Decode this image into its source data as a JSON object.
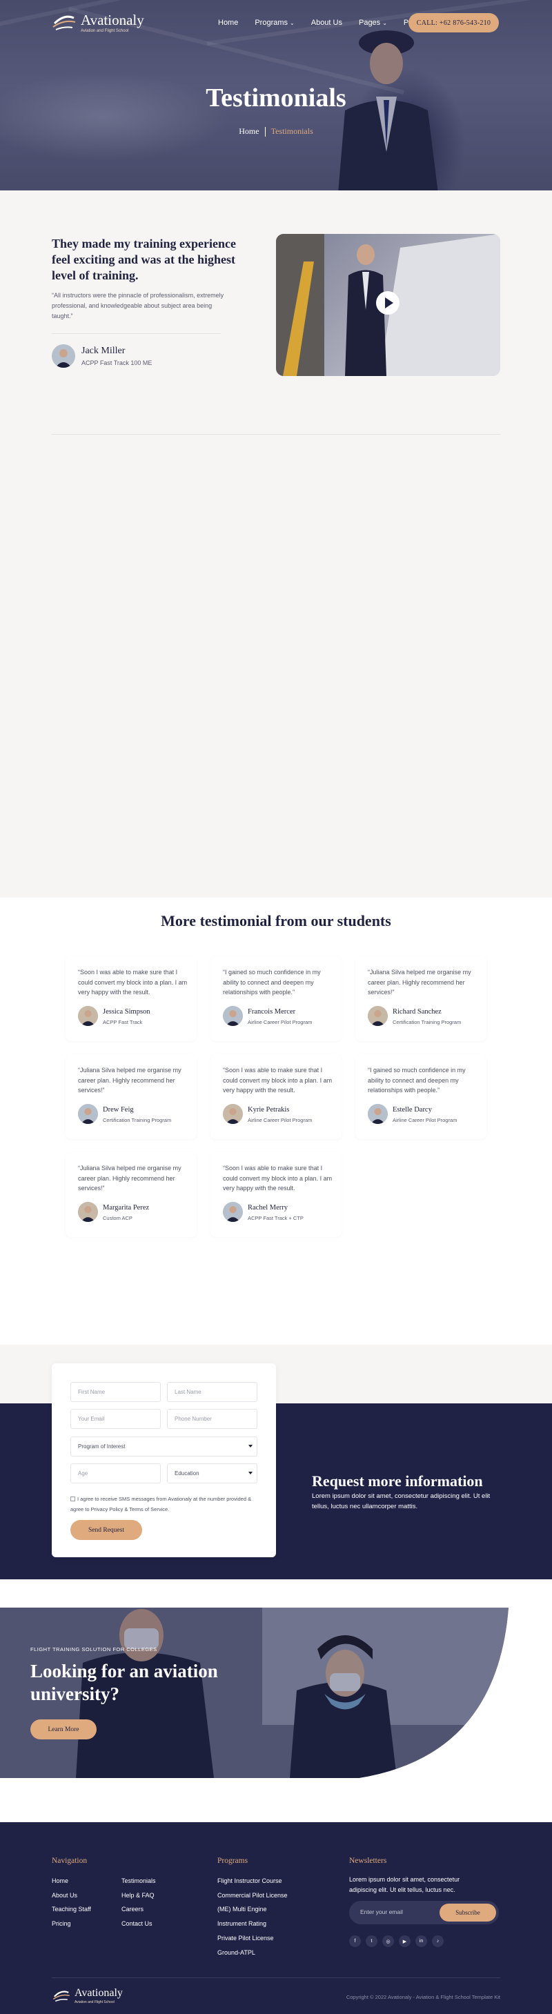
{
  "brand": {
    "name": "Avationaly",
    "tagline": "Aviation and Flight School"
  },
  "nav": {
    "items": [
      {
        "label": "Home"
      },
      {
        "label": "Programs",
        "dropdown": true
      },
      {
        "label": "About Us"
      },
      {
        "label": "Pages",
        "dropdown": true
      },
      {
        "label": "Pricing"
      }
    ],
    "call_label": "CALL: +62 876-543-210"
  },
  "hero": {
    "title": "Testimonials",
    "breadcrumb_home": "Home",
    "breadcrumb_current": "Testimonials"
  },
  "featured": {
    "heading": "They made my training experience feel exciting and was at the highest level of training.",
    "quote": "“All instructors were the pinnacle of professionalism, extremely professional, and knowledgeable about subject area being taught.”",
    "author_name": "Jack Miller",
    "author_role": "ACPP Fast Track 100 ME",
    "play_icon": "play-icon"
  },
  "more": {
    "title": "More testimonial from our students",
    "cards": [
      {
        "quote": "“Soon I was able to make sure that I could convert my block into a plan. I am very happy with the result.",
        "name": "Jessica Simpson",
        "role": "ACPP Fast Track"
      },
      {
        "quote": "“I gained so much confidence in my ability to connect and deepen my relationships with people.”",
        "name": "Francois Mercer",
        "role": "Airline Career Pilot Program"
      },
      {
        "quote": "“Juliana Silva helped me organise my career plan. Highly recommend her services!”",
        "name": "Richard Sanchez",
        "role": "Certification Training Program"
      },
      {
        "quote": "“Juliana Silva helped me organise my career plan. Highly recommend her services!”",
        "name": "Drew Feig",
        "role": "Certification Training Program"
      },
      {
        "quote": "“Soon I was able to make sure that I could convert my block into a plan. I am very happy with the result.",
        "name": "Kyrie Petrakis",
        "role": "Airline Career Pilot Program"
      },
      {
        "quote": "“I gained so much confidence in my ability to connect and deepen my relationships with people.”",
        "name": "Estelle Darcy",
        "role": "Airline Career Pilot Program"
      },
      {
        "quote": "“Juliana Silva helped me organise my career plan. Highly recommend her services!”",
        "name": "Margarita Perez",
        "role": "Custom ACP"
      },
      {
        "quote": "“Soon I was able to make sure that I could convert my block into a plan. I am very happy with the result.",
        "name": "Rachel Merry",
        "role": "ACPP Fast Track + CTP"
      }
    ]
  },
  "form": {
    "first_name": "First Name",
    "last_name": "Last Name",
    "email": "Your Email",
    "phone": "Phone Number",
    "program": "Program of Interest",
    "age": "Age",
    "education": "Education",
    "consent": "I agree to receive SMS messages from Avationaly at the number provided & agree to Privacy Policy & Terms of Service.",
    "submit": "Send Request"
  },
  "request": {
    "title": "Request more information",
    "text_line1": "Lorem ipsum dolor sit amet, consectetur adipiscing elit. Ut elit",
    "text_line2": "tellus, luctus nec ullamcorper mattis."
  },
  "cta": {
    "eyebrow": "FLIGHT TRAINING SOLUTION FOR COLLEGES",
    "title": "Looking for an aviation university?",
    "button": "Learn More"
  },
  "footer": {
    "nav_heading": "Navigation",
    "nav_col1": [
      "Home",
      "About Us",
      "Teaching Staff",
      "Pricing"
    ],
    "nav_col2": [
      "Testimonials",
      "Help & FAQ",
      "Careers",
      "Contact Us"
    ],
    "programs_heading": "Programs",
    "programs": [
      "Flight Instructor Course",
      "Commercial Pilot License",
      "(ME) Multi Engine",
      "Instrument Rating",
      "Private Pilot License",
      "Ground-ATPL"
    ],
    "news_heading": "Newsletters",
    "news_text": "Lorem ipsum dolor sit amet, consectetur adipiscing elit. Ut elit tellus, luctus nec.",
    "news_placeholder": "Enter your email",
    "news_button": "Subscribe",
    "socials": [
      {
        "icon": "facebook-icon",
        "glyph": "f"
      },
      {
        "icon": "twitter-icon",
        "glyph": "t"
      },
      {
        "icon": "instagram-icon",
        "glyph": "◎"
      },
      {
        "icon": "youtube-icon",
        "glyph": "▶"
      },
      {
        "icon": "linkedin-icon",
        "glyph": "in"
      },
      {
        "icon": "tiktok-icon",
        "glyph": "♪"
      }
    ],
    "copyright": "Copyright © 2022 Avationaly - Aviation & Flight School Template Kit"
  },
  "colors": {
    "navy": "#1f2145",
    "accent": "#deaa7e",
    "bg": "#f7f5f3"
  }
}
